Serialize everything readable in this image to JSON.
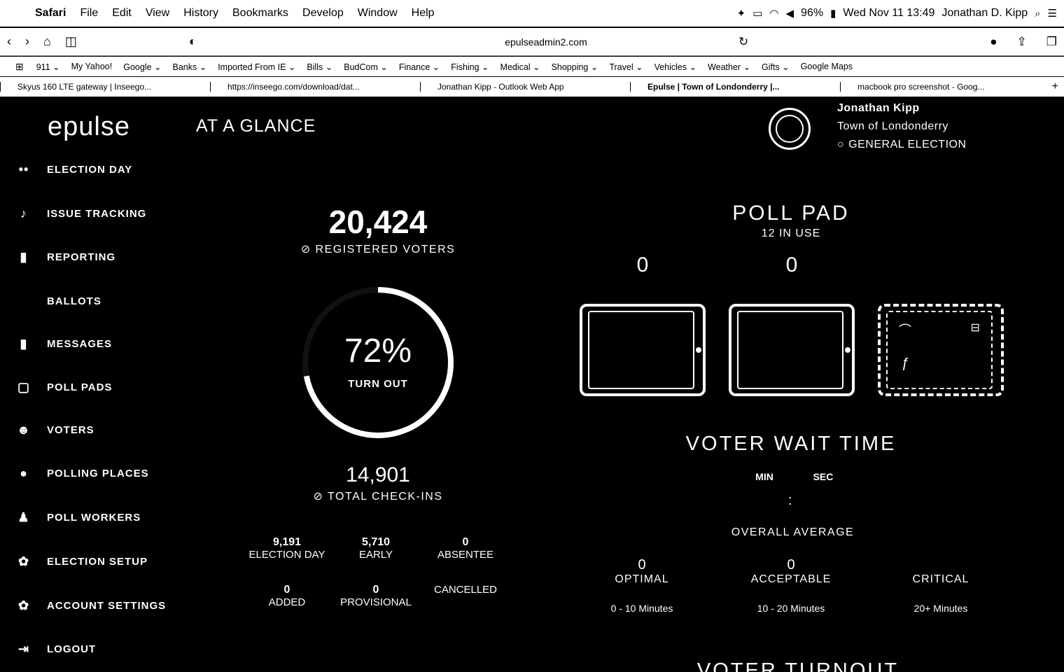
{
  "menubar": {
    "items": [
      "Safari",
      "File",
      "Edit",
      "View",
      "History",
      "Bookmarks",
      "Develop",
      "Window",
      "Help"
    ],
    "battery": "96%",
    "datetime": "Wed Nov 11  13:49",
    "user": "Jonathan D. Kipp"
  },
  "toolbar": {
    "address": "epulseadmin2.com"
  },
  "bookmarks": [
    "911 ⌄",
    "My Yahoo!",
    "Google ⌄",
    "Banks ⌄",
    "Imported From IE ⌄",
    "Bills ⌄",
    "BudCom ⌄",
    "Finance ⌄",
    "Fishing ⌄",
    "Medical ⌄",
    "Shopping ⌄",
    "Travel ⌄",
    "Vehicles ⌄",
    "Weather ⌄",
    "Gifts ⌄",
    "Google Maps"
  ],
  "tabs": [
    "Skyus 160 LTE gateway | Inseego...",
    "https://inseego.com/download/dat...",
    "Jonathan Kipp - Outlook Web App",
    "Epulse | Town of Londonderry |...",
    "macbook pro screenshot - Goog..."
  ],
  "app": {
    "logo": "epulse",
    "page_title": "AT A GLANCE",
    "user_name": "Jonathan Kipp",
    "org": "Town of Londonderry",
    "election": "GENERAL ELECTION"
  },
  "nav": [
    {
      "label": "ELECTION DAY",
      "icon": "••"
    },
    {
      "label": "ISSUE TRACKING",
      "icon": "♪"
    },
    {
      "label": "REPORTING",
      "icon": "▮"
    },
    {
      "label": "BALLOTS",
      "icon": ""
    },
    {
      "label": "MESSAGES",
      "icon": "▮"
    },
    {
      "label": "POLL PADS",
      "icon": "▢"
    },
    {
      "label": "VOTERS",
      "icon": "☻"
    },
    {
      "label": "POLLING PLACES",
      "icon": "●"
    },
    {
      "label": "POLL WORKERS",
      "icon": "♟"
    },
    {
      "label": "ELECTION SETUP",
      "icon": "✿"
    },
    {
      "label": "ACCOUNT SETTINGS",
      "icon": "✿"
    },
    {
      "label": "LOGOUT",
      "icon": "⇥"
    }
  ],
  "stats": {
    "registered_voters": "20,424",
    "registered_label": "REGISTERED VOTERS",
    "turnout_pct": "72%",
    "turnout_fraction": 0.72,
    "turnout_label": "TURN OUT",
    "total_checkins": "14,901",
    "checkins_label": "TOTAL CHECK-INS",
    "breakdown": [
      {
        "value": "9,191",
        "label": "ELECTION DAY"
      },
      {
        "value": "5,710",
        "label": "EARLY"
      },
      {
        "value": "0",
        "label": "ABSENTEE"
      },
      {
        "value": "0",
        "label": "ADDED"
      },
      {
        "value": "0",
        "label": "PROVISIONAL"
      },
      {
        "value": "",
        "label": "CANCELLED"
      }
    ]
  },
  "poll_pad": {
    "title": "POLL PAD",
    "in_use": "12 IN USE",
    "pads": [
      {
        "count": "0"
      },
      {
        "count": "0"
      },
      {
        "count": ""
      }
    ]
  },
  "wait_time": {
    "title": "VOTER WAIT TIME",
    "min_label": "MIN",
    "sec_label": "SEC",
    "separator": ":",
    "overall_label": "OVERALL AVERAGE",
    "categories": [
      {
        "count": "0",
        "label": "OPTIMAL",
        "range": "0 - 10 Minutes"
      },
      {
        "count": "0",
        "label": "ACCEPTABLE",
        "range": "10 - 20 Minutes"
      },
      {
        "count": "",
        "label": "CRITICAL",
        "range": "20+ Minutes"
      }
    ]
  },
  "voter_turnout_title": "VOTER TURNOUT"
}
